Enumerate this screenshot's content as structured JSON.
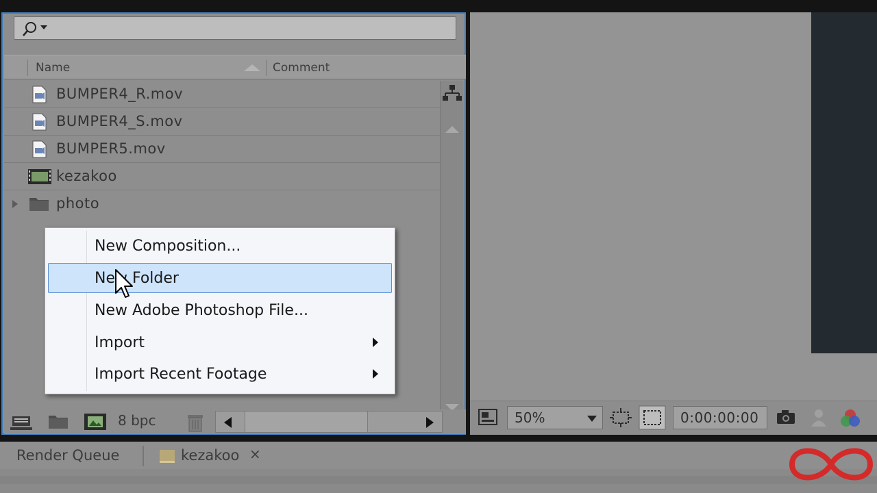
{
  "project_panel": {
    "search_placeholder": "",
    "columns": {
      "name": "Name",
      "comment": "Comment"
    },
    "items": [
      {
        "name": "BUMPER4_R.mov",
        "type": "movie-file-icon"
      },
      {
        "name": "BUMPER4_S.mov",
        "type": "movie-file-icon"
      },
      {
        "name": "BUMPER5.mov",
        "type": "movie-file-icon"
      },
      {
        "name": "kezakoo",
        "type": "composition-icon"
      },
      {
        "name": "photo",
        "type": "folder-icon"
      }
    ],
    "bit_depth": "8 bpc"
  },
  "context_menu": {
    "items": [
      {
        "label": "New Composition...",
        "has_submenu": false
      },
      {
        "label": "New Folder",
        "has_submenu": false,
        "highlighted": true
      },
      {
        "label": "New Adobe Photoshop File...",
        "has_submenu": false
      },
      {
        "label": "Import",
        "has_submenu": true
      },
      {
        "label": "Import Recent Footage",
        "has_submenu": true
      }
    ]
  },
  "viewer": {
    "zoom": "50%",
    "timecode": "0:00:00:00"
  },
  "tabs": {
    "render_queue": "Render Queue",
    "composition": "kezakoo",
    "close": "×"
  },
  "colors": {
    "panel_border": "#3f7fc0",
    "menu_highlight": "#cde4fb",
    "logo_red": "#d42a2a"
  }
}
